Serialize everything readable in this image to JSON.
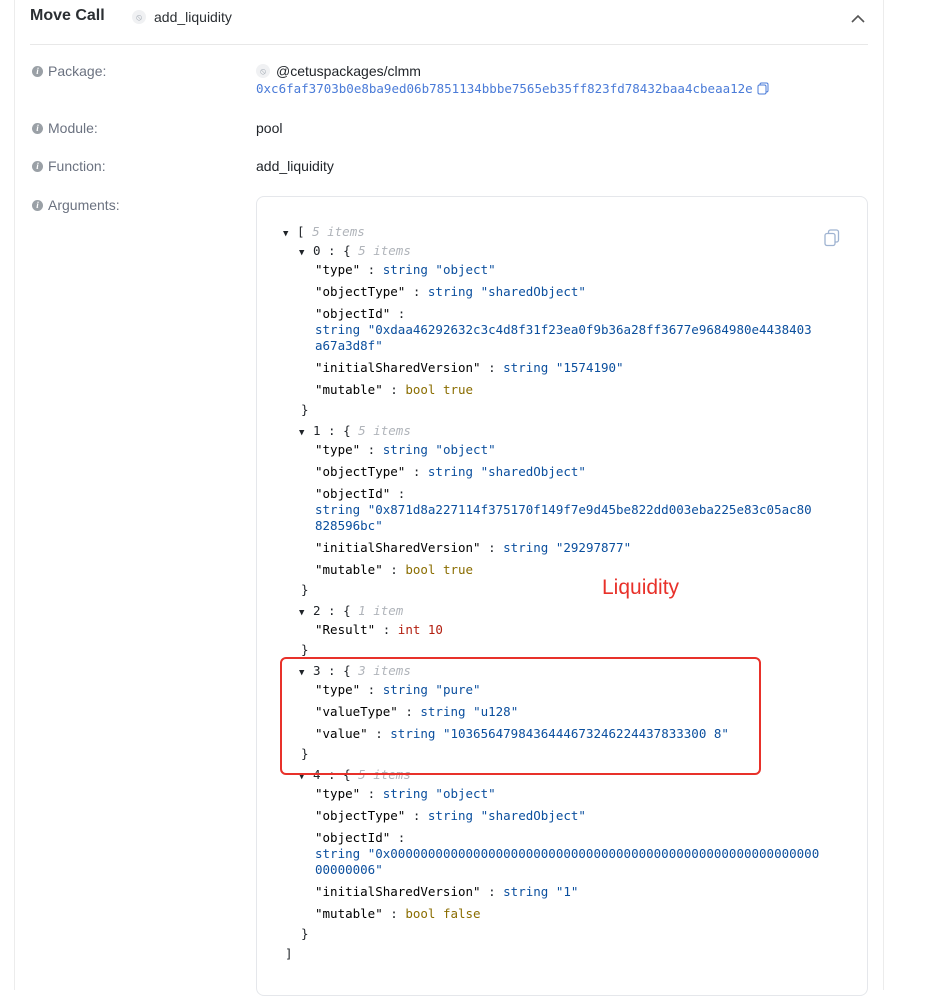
{
  "header": {
    "title": "Move Call",
    "function_chip": "add_liquidity"
  },
  "labels": {
    "package": "Package:",
    "module": "Module:",
    "function": "Function:",
    "arguments": "Arguments:"
  },
  "package": {
    "name": "@cetuspackages/clmm",
    "address": "0xc6faf3703b0e8ba9ed06b7851134bbbe7565eb35ff823fd78432baa4cbeaa12e"
  },
  "module": "pool",
  "function": "add_liquidity",
  "json": {
    "root_open": "[",
    "root_count": "5 items",
    "root_close": "]",
    "items": [
      {
        "index": "0",
        "count": "5 items",
        "type_val": "\"object\"",
        "objectType_val": "\"sharedObject\"",
        "objectId_val_1": "\"0xdaa46292632c3c4d8f31f23ea0f9b36a28ff3677e9684980e4438403",
        "objectId_val_2": "a67a3d8f\"",
        "isv_val": "\"1574190\"",
        "mutable_val": "true"
      },
      {
        "index": "1",
        "count": "5 items",
        "type_val": "\"object\"",
        "objectType_val": "\"sharedObject\"",
        "objectId_val_1": "\"0x871d8a227114f375170f149f7e9d45be822dd003eba225e83c05ac80",
        "objectId_val_2": "828596bc\"",
        "isv_val": "\"29297877\"",
        "mutable_val": "true"
      },
      {
        "index": "2",
        "count": "1 item",
        "result_val": "10"
      },
      {
        "index": "3",
        "count": "3 items",
        "type_val": "\"pure\"",
        "valueType_val": "\"u128\"",
        "value_val": "\"1036564798436444673246224437833300 8\""
      },
      {
        "index": "4",
        "count": "5 items",
        "type_val": "\"object\"",
        "objectType_val": "\"sharedObject\"",
        "objectId_val_1": "\"0x000000000000000000000000000000000000000000000000000000000",
        "objectId_val_2": "00000006\"",
        "isv_val": "\"1\"",
        "mutable_val": "false"
      }
    ],
    "keys": {
      "type": "\"type\"",
      "objectType": "\"objectType\"",
      "objectId": "\"objectId\"",
      "isv": "\"initialSharedVersion\"",
      "mutable": "\"mutable\"",
      "result": "\"Result\"",
      "valueType": "\"valueType\"",
      "value": "\"value\""
    },
    "types": {
      "string": "string",
      "bool": "bool",
      "int": "int"
    }
  },
  "annotation": {
    "text": "Liquidity",
    "color": "#e8312a"
  }
}
